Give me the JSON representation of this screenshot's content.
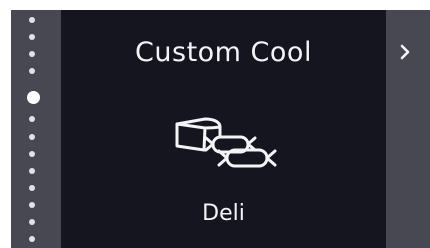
{
  "screen": {
    "title": "Custom Cool",
    "mode_label": "Deli",
    "icon": "deli-cheese-sausage-icon",
    "pager": {
      "total": 12,
      "active_index": 4
    },
    "next_icon": "chevron-right-icon"
  },
  "colors": {
    "background": "#15151f",
    "side_panels": "#484852",
    "text": "#f4f4f6",
    "dot": "#e2e2e6"
  }
}
